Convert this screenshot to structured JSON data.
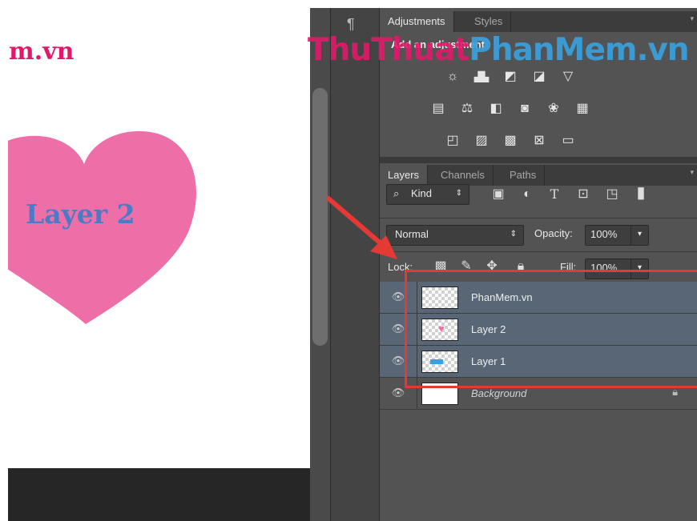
{
  "document": {
    "title": "m.vn",
    "heart_label": "Layer 2"
  },
  "watermark": {
    "part1": "ThuThuat",
    "part2": "PhanMem.vn"
  },
  "adjustments_panel": {
    "tabs": [
      {
        "label": "Adjustments",
        "active": true
      },
      {
        "label": "Styles",
        "active": false
      }
    ],
    "subtitle": "Add an adjustment",
    "rows": [
      [
        "brightness-contrast",
        "levels",
        "curves",
        "exposure",
        "gradient-triangle"
      ],
      [
        "vibrance",
        "balance",
        "black-white",
        "photo-filter",
        "channel-mixer",
        "color-lookup"
      ],
      [
        "invert",
        "posterize",
        "threshold",
        "selective-color",
        "gradient-map"
      ]
    ]
  },
  "layers_panel": {
    "tabs": [
      {
        "label": "Layers",
        "active": true
      },
      {
        "label": "Channels",
        "active": false
      },
      {
        "label": "Paths",
        "active": false
      }
    ],
    "filter": {
      "label": "Kind"
    },
    "blend_mode": "Normal",
    "opacity_label": "Opacity:",
    "opacity_value": "100%",
    "lock_label": "Lock:",
    "fill_label": "Fill:",
    "fill_value": "100%",
    "layers": [
      {
        "name": "PhanMem.vn",
        "selected": true,
        "thumbnail": "transparent"
      },
      {
        "name": "Layer 2",
        "selected": true,
        "thumbnail": "pink-heart"
      },
      {
        "name": "Layer 1",
        "selected": true,
        "thumbnail": "blue-shape"
      },
      {
        "name": "Background",
        "selected": false,
        "thumbnail": "white",
        "locked": true
      }
    ]
  },
  "colors": {
    "heart": "#ee6fa7",
    "title_text": "#e01a6a",
    "heart_text": "#4a7bc8",
    "selection": "#596676",
    "annotation_red": "#e53935"
  }
}
